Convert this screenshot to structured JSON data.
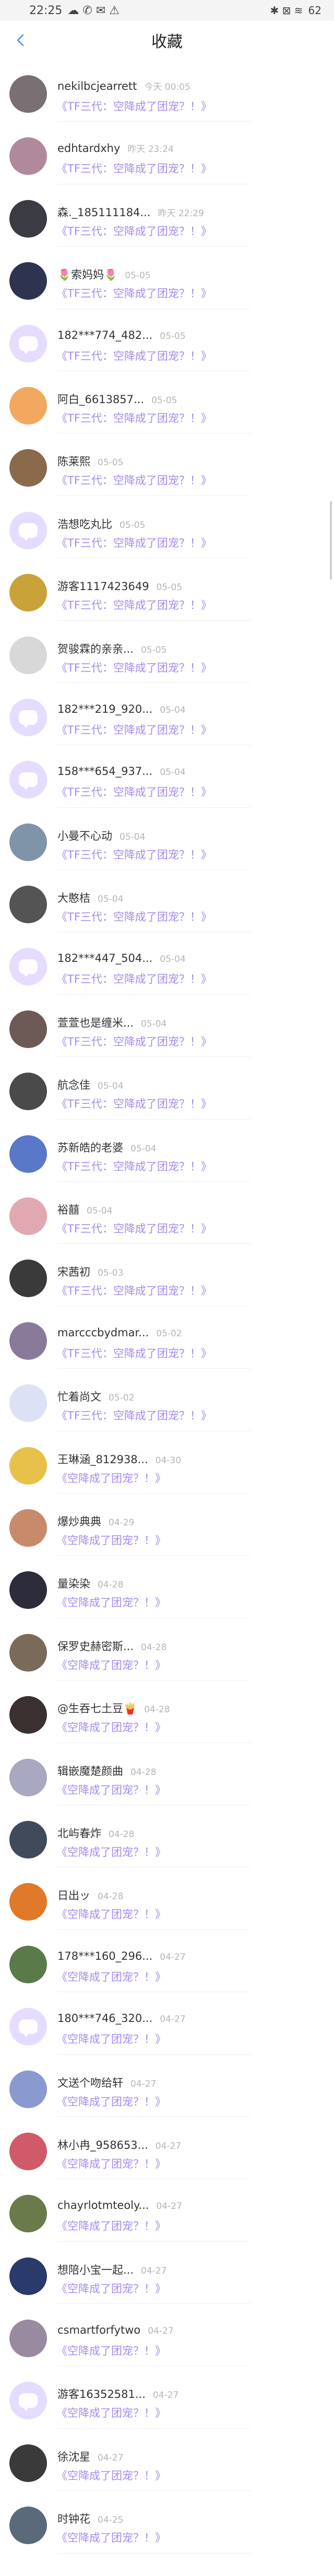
{
  "status": {
    "time": "22:25",
    "battery": "62"
  },
  "nav": {
    "title": "收藏",
    "back_icon": "chevron-left-icon"
  },
  "items": [
    {
      "name": "nekilbcjearrett",
      "time": "今天 00:05",
      "work": "《TF三代：空降成了团宠？！》",
      "avatar_color": "#7a6f72",
      "placeholder": false
    },
    {
      "name": "edhtardxhy",
      "time": "昨天 23:24",
      "work": "《TF三代：空降成了团宠？！》",
      "avatar_color": "#b08a9c",
      "placeholder": false
    },
    {
      "name": "森._185111184...",
      "time": "昨天 22:29",
      "work": "《TF三代：空降成了团宠？！》",
      "avatar_color": "#3b3b44",
      "placeholder": false
    },
    {
      "name": "🌷索妈妈🌷",
      "time": "05-05",
      "work": "《TF三代：空降成了团宠？！》",
      "avatar_color": "#2e3450",
      "placeholder": false
    },
    {
      "name": "182***774_482...",
      "time": "05-05",
      "work": "《TF三代：空降成了团宠？！》",
      "avatar_color": "#e6dcff",
      "placeholder": true
    },
    {
      "name": "阿白_6613857...",
      "time": "05-05",
      "work": "《TF三代：空降成了团宠？！》",
      "avatar_color": "#f3a860",
      "placeholder": false
    },
    {
      "name": "陈莱熙",
      "time": "05-05",
      "work": "《TF三代：空降成了团宠？！》",
      "avatar_color": "#8a6a4a",
      "placeholder": false
    },
    {
      "name": "浩想吃丸比",
      "time": "05-05",
      "work": "《TF三代：空降成了团宠？！》",
      "avatar_color": "#e6dcff",
      "placeholder": true
    },
    {
      "name": "游客1117423649",
      "time": "05-05",
      "work": "《TF三代：空降成了团宠？！》",
      "avatar_color": "#c9a23a",
      "placeholder": false
    },
    {
      "name": "贺骏霖的亲亲...",
      "time": "05-05",
      "work": "《TF三代：空降成了团宠？！》",
      "avatar_color": "#d8d8d8",
      "placeholder": false
    },
    {
      "name": "182***219_920...",
      "time": "05-04",
      "work": "《TF三代：空降成了团宠？！》",
      "avatar_color": "#e6dcff",
      "placeholder": true
    },
    {
      "name": "158***654_937...",
      "time": "05-04",
      "work": "《TF三代：空降成了团宠？！》",
      "avatar_color": "#e6dcff",
      "placeholder": true
    },
    {
      "name": "小曼不心动",
      "time": "05-04",
      "work": "《TF三代：空降成了团宠？！》",
      "avatar_color": "#7f94a8",
      "placeholder": false
    },
    {
      "name": "大憨桔",
      "time": "05-04",
      "work": "《TF三代：空降成了团宠？！》",
      "avatar_color": "#545454",
      "placeholder": false
    },
    {
      "name": "182***447_504...",
      "time": "05-04",
      "work": "《TF三代：空降成了团宠？！》",
      "avatar_color": "#e6dcff",
      "placeholder": true
    },
    {
      "name": "萱萱也是缠米...",
      "time": "05-04",
      "work": "《TF三代：空降成了团宠？！》",
      "avatar_color": "#6d5a56",
      "placeholder": false
    },
    {
      "name": "航念佳",
      "time": "05-04",
      "work": "《TF三代：空降成了团宠？！》",
      "avatar_color": "#4a4a4a",
      "placeholder": false
    },
    {
      "name": "苏新皓的老婆",
      "time": "05-04",
      "work": "《TF三代：空降成了团宠？！》",
      "avatar_color": "#5a78c8",
      "placeholder": false
    },
    {
      "name": "裕囍",
      "time": "05-04",
      "work": "《TF三代：空降成了团宠？！》",
      "avatar_color": "#e0a8b0",
      "placeholder": false
    },
    {
      "name": "宋茜初",
      "time": "05-03",
      "work": "《TF三代：空降成了团宠？！》",
      "avatar_color": "#3a3a3a",
      "placeholder": false
    },
    {
      "name": "marcccbydmar...",
      "time": "05-02",
      "work": "《TF三代：空降成了团宠？！》",
      "avatar_color": "#8a7a9a",
      "placeholder": false
    },
    {
      "name": "忙着尚文",
      "time": "05-02",
      "work": "《TF三代：空降成了团宠？！》",
      "avatar_color": "#dde1f5",
      "placeholder": false
    },
    {
      "name": "王琳涵_812938...",
      "time": "04-30",
      "work": "《空降成了团宠？！》",
      "avatar_color": "#e8c14a",
      "placeholder": false
    },
    {
      "name": "爆炒典典",
      "time": "04-29",
      "work": "《空降成了团宠？！》",
      "avatar_color": "#c78a6a",
      "placeholder": false
    },
    {
      "name": "量染染",
      "time": "04-28",
      "work": "《空降成了团宠？！》",
      "avatar_color": "#2c2c3a",
      "placeholder": false
    },
    {
      "name": "保罗史赫密斯...",
      "time": "04-28",
      "work": "《空降成了团宠？！》",
      "avatar_color": "#7a6a5a",
      "placeholder": false
    },
    {
      "name": "@生吞七土豆🍟",
      "time": "04-28",
      "work": "《空降成了团宠？！》",
      "avatar_color": "#3a3030",
      "placeholder": false
    },
    {
      "name": "辑嵌魔楚颜曲",
      "time": "04-28",
      "work": "《空降成了团宠？！》",
      "avatar_color": "#a8a8c0",
      "placeholder": false
    },
    {
      "name": "北屿春炸",
      "time": "04-28",
      "work": "《空降成了团宠？！》",
      "avatar_color": "#404a5a",
      "placeholder": false
    },
    {
      "name": "日出ッ",
      "time": "04-28",
      "work": "《空降成了团宠？！》",
      "avatar_color": "#e07a2a",
      "placeholder": false
    },
    {
      "name": "178***160_296...",
      "time": "04-27",
      "work": "《空降成了团宠？！》",
      "avatar_color": "#5a7a4a",
      "placeholder": false
    },
    {
      "name": "180***746_320...",
      "time": "04-27",
      "work": "《空降成了团宠？！》",
      "avatar_color": "#e6dcff",
      "placeholder": true
    },
    {
      "name": "文送个吻给轩",
      "time": "04-27",
      "work": "《空降成了团宠？！》",
      "avatar_color": "#8a9ad0",
      "placeholder": false
    },
    {
      "name": "林小冉_958653...",
      "time": "04-27",
      "work": "《空降成了团宠？！》",
      "avatar_color": "#d05a6a",
      "placeholder": false
    },
    {
      "name": "chayrlotmteoly...",
      "time": "04-27",
      "work": "《空降成了团宠？！》",
      "avatar_color": "#6a7a4a",
      "placeholder": false
    },
    {
      "name": "想陪小宝一起...",
      "time": "04-27",
      "work": "《空降成了团宠？！》",
      "avatar_color": "#2a3a6a",
      "placeholder": false
    },
    {
      "name": "csmartforfytwo",
      "time": "04-27",
      "work": "《空降成了团宠？！》",
      "avatar_color": "#9a8aa0",
      "placeholder": false
    },
    {
      "name": "游客16352581...",
      "time": "04-27",
      "work": "《空降成了团宠？！》",
      "avatar_color": "#e6dcff",
      "placeholder": true
    },
    {
      "name": "徐沈星",
      "time": "04-27",
      "work": "《空降成了团宠？！》",
      "avatar_color": "#3a3a3a",
      "placeholder": false
    },
    {
      "name": "时钟花",
      "time": "04-25",
      "work": "《空降成了团宠？！》",
      "avatar_color": "#5a6a7a",
      "placeholder": false
    }
  ]
}
